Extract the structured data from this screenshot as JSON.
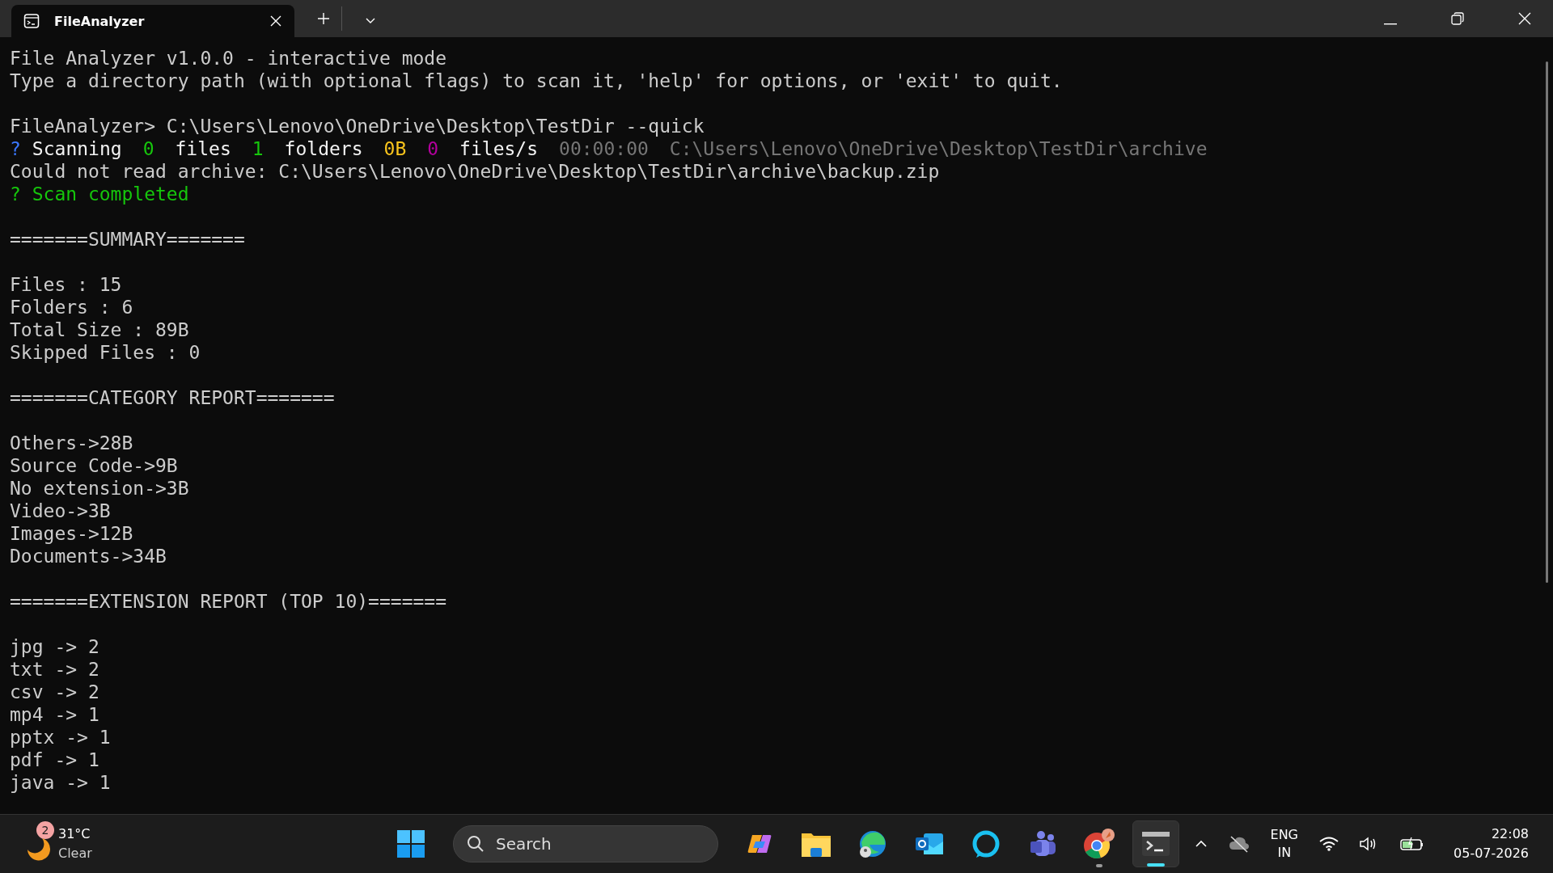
{
  "tabs": [
    {
      "title": "FileAnalyzer",
      "selected": true
    }
  ],
  "terminal": {
    "blocks": [
      {
        "lines": [
          {
            "segments": [
              {
                "text": "File Analyzer v1.0.0 - interactive mode",
                "color": "#cccccc"
              }
            ]
          },
          {
            "segments": [
              {
                "text": "Type a directory path (with optional flags) to scan it, 'help' for options, or 'exit' to quit.",
                "color": "#cccccc"
              }
            ]
          }
        ]
      },
      {
        "lines": [
          {
            "segments": [
              {
                "text": "FileAnalyzer> C:\\Users\\Lenovo\\OneDrive\\Desktop\\TestDir --quick",
                "color": "#cccccc"
              }
            ]
          },
          {
            "segments": [
              {
                "text": "?",
                "color": "#3b78ff"
              },
              {
                "text": "Scanning",
                "color": "#f2f2f2"
              },
              {
                "text": "0",
                "color": "#16c60c"
              },
              {
                "text": "files",
                "color": "#f2f2f2"
              },
              {
                "text": "1",
                "color": "#16c60c"
              },
              {
                "text": "folders",
                "color": "#f2f2f2"
              },
              {
                "text": "0B",
                "color": "#f9c41c"
              },
              {
                "text": "0",
                "color": "#b4009e"
              },
              {
                "text": "files/s",
                "color": "#f2f2f2"
              },
              {
                "text": "00:00:00",
                "color": "#767676"
              },
              {
                "text": "C:\\Users\\Lenovo\\OneDrive\\Desktop\\TestDir\\archive",
                "color": "#767676"
              }
            ]
          },
          {
            "segments": [
              {
                "text": "Could not read archive: C:\\Users\\Lenovo\\OneDrive\\Desktop\\TestDir\\archive\\backup.zip",
                "color": "#cccccc"
              }
            ]
          },
          {
            "segments": [
              {
                "text": "? Scan completed",
                "color": "#16c60c"
              }
            ]
          }
        ]
      },
      {
        "lines": [
          {
            "segments": [
              {
                "text": "=======SUMMARY=======",
                "color": "#cccccc"
              }
            ]
          }
        ]
      },
      {
        "lines": [
          {
            "segments": [
              {
                "text": "Files : 15",
                "color": "#cccccc"
              }
            ]
          },
          {
            "segments": [
              {
                "text": "Folders : 6",
                "color": "#cccccc"
              }
            ]
          },
          {
            "segments": [
              {
                "text": "Total Size : 89B",
                "color": "#cccccc"
              }
            ]
          },
          {
            "segments": [
              {
                "text": "Skipped Files : 0",
                "color": "#cccccc"
              }
            ]
          }
        ]
      },
      {
        "lines": [
          {
            "segments": [
              {
                "text": "=======CATEGORY REPORT=======",
                "color": "#cccccc"
              }
            ]
          }
        ]
      },
      {
        "lines": [
          {
            "segments": [
              {
                "text": "Others->28B",
                "color": "#cccccc"
              }
            ]
          },
          {
            "segments": [
              {
                "text": "Source Code->9B",
                "color": "#cccccc"
              }
            ]
          },
          {
            "segments": [
              {
                "text": "No extension->3B",
                "color": "#cccccc"
              }
            ]
          },
          {
            "segments": [
              {
                "text": "Video->3B",
                "color": "#cccccc"
              }
            ]
          },
          {
            "segments": [
              {
                "text": "Images->12B",
                "color": "#cccccc"
              }
            ]
          },
          {
            "segments": [
              {
                "text": "Documents->34B",
                "color": "#cccccc"
              }
            ]
          }
        ]
      },
      {
        "lines": [
          {
            "segments": [
              {
                "text": "=======EXTENSION REPORT (TOP 10)=======",
                "color": "#cccccc"
              }
            ]
          }
        ]
      },
      {
        "lines": [
          {
            "segments": [
              {
                "text": "jpg -> 2",
                "color": "#cccccc"
              }
            ]
          },
          {
            "segments": [
              {
                "text": "txt -> 2",
                "color": "#cccccc"
              }
            ]
          },
          {
            "segments": [
              {
                "text": "csv -> 2",
                "color": "#cccccc"
              }
            ]
          },
          {
            "segments": [
              {
                "text": "mp4 -> 1",
                "color": "#cccccc"
              }
            ]
          },
          {
            "segments": [
              {
                "text": "pptx -> 1",
                "color": "#cccccc"
              }
            ]
          },
          {
            "segments": [
              {
                "text": "pdf -> 1",
                "color": "#cccccc"
              }
            ]
          },
          {
            "segments": [
              {
                "text": "java -> 1",
                "color": "#cccccc"
              }
            ]
          }
        ]
      }
    ]
  },
  "taskbar": {
    "weather": {
      "badge": "2",
      "temperature": "31°C",
      "condition": "Clear"
    },
    "search": {
      "placeholder": "Search"
    },
    "apps": [
      {
        "kind": "copilot",
        "running": false,
        "selected": false
      },
      {
        "kind": "folder",
        "running": false,
        "selected": false
      },
      {
        "kind": "edge",
        "running": false,
        "selected": false
      },
      {
        "kind": "outlook",
        "running": false,
        "selected": false
      },
      {
        "kind": "alexa",
        "running": false,
        "selected": false
      },
      {
        "kind": "teams",
        "running": false,
        "selected": false
      },
      {
        "kind": "chrome",
        "running": true,
        "selected": false
      },
      {
        "kind": "terminal",
        "running": true,
        "selected": true
      }
    ],
    "language": [
      "ENG",
      "IN"
    ],
    "time": "22:08",
    "date": "05-07-2026"
  }
}
